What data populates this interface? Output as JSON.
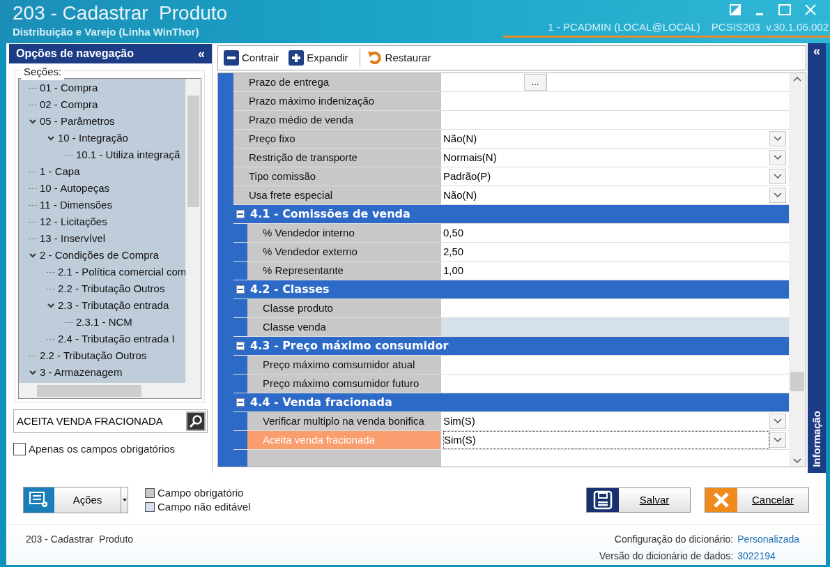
{
  "window": {
    "title": "203 - Cadastrar  Produto",
    "subtitle": "Distribuição e Varejo (Linha WinThor)",
    "user": "1 - PCADMIN (LOCAL@LOCAL)",
    "version": "PCSIS203  v.30.1.06.002"
  },
  "navigation": {
    "title": "Opções de navegação",
    "collapse": "«",
    "sections_label": "Seções:",
    "tree": [
      {
        "label": "01 - Compra"
      },
      {
        "label": "02 - Compra"
      },
      {
        "label": "05 - Parâmetros",
        "expanded": true,
        "children": [
          {
            "label": "10 - Integração",
            "expanded": true,
            "children": [
              {
                "label": "10.1 - Utiliza integraçã"
              }
            ]
          }
        ]
      },
      {
        "label": "1 - Capa"
      },
      {
        "label": "10 - Autopeças"
      },
      {
        "label": "11 - Dimensões"
      },
      {
        "label": "12 - Licitações"
      },
      {
        "label": "13 - Inservível"
      },
      {
        "label": "2 - Condições de Compra",
        "expanded": true,
        "children": [
          {
            "label": "2.1 - Política comercial com"
          },
          {
            "label": "2.2 - Tributação Outros"
          },
          {
            "label": "2.3 - Tributação entrada",
            "expanded": true,
            "children": [
              {
                "label": "2.3.1 - NCM"
              }
            ]
          },
          {
            "label": "2.4 - Tributação entrada I"
          }
        ]
      },
      {
        "label": "2.2 - Tributação Outros"
      },
      {
        "label": "3 - Armazenagem",
        "expanded": true
      }
    ],
    "search": {
      "value": "ACEITA VENDA FRACIONADA"
    },
    "only_required": {
      "label": "Apenas os campos obrigatórios",
      "checked": false
    }
  },
  "toolbar": [
    {
      "kind": "collapse",
      "label": "Contrair"
    },
    {
      "kind": "expand",
      "label": "Expandir"
    },
    {
      "kind": "restore",
      "label": "Restaurar"
    }
  ],
  "grid": {
    "rows": [
      {
        "label": "Prazo de entrega",
        "kind": "ellipsis",
        "value": "",
        "ellipsis": "...",
        "selected": false,
        "disabled": false
      },
      {
        "label": "Prazo máximo indenização",
        "kind": "text",
        "value": "",
        "selected": false,
        "disabled": false
      },
      {
        "label": "Prazo médio de venda",
        "kind": "text",
        "value": "",
        "selected": false,
        "disabled": false
      },
      {
        "label": "Preço fixo",
        "kind": "dropdown",
        "value": "Não(N)",
        "selected": false,
        "disabled": false
      },
      {
        "label": "Restrição de transporte",
        "kind": "dropdown",
        "value": "Normais(N)",
        "selected": false,
        "disabled": false
      },
      {
        "label": "Tipo comissão",
        "kind": "dropdown",
        "value": "Padrão(P)",
        "selected": false,
        "disabled": false
      },
      {
        "label": "Usa frete especial",
        "kind": "dropdown",
        "value": "Não(N)",
        "selected": false,
        "disabled": false
      }
    ],
    "sections": [
      {
        "title": "4.1 - Comissões de venda",
        "expanded": true,
        "rows": [
          {
            "label": "% Vendedor interno",
            "kind": "text",
            "value": "0,50",
            "selected": false,
            "disabled": false
          },
          {
            "label": "% Vendedor externo",
            "kind": "text",
            "value": "2,50",
            "selected": false,
            "disabled": false
          },
          {
            "label": "% Representante",
            "kind": "text",
            "value": "1,00",
            "selected": false,
            "disabled": false
          }
        ]
      },
      {
        "title": "4.2 - Classes",
        "expanded": true,
        "rows": [
          {
            "label": "Classe produto",
            "kind": "text",
            "value": "",
            "selected": false,
            "disabled": false
          },
          {
            "label": "Classe venda",
            "kind": "text",
            "value": "",
            "selected": false,
            "disabled": true
          }
        ]
      },
      {
        "title": "4.3 - Preço máximo consumidor",
        "expanded": true,
        "rows": [
          {
            "label": "Preço máximo comsumidor atual",
            "kind": "text",
            "value": "",
            "selected": false,
            "disabled": false
          },
          {
            "label": "Preço máximo comsumidor futuro",
            "kind": "text",
            "value": "",
            "selected": false,
            "disabled": false
          }
        ]
      },
      {
        "title": "4.4 - Venda fracionada",
        "expanded": true,
        "rows": [
          {
            "label": "Verificar multiplo na venda bonifica",
            "kind": "dropdown",
            "value": "Sim(S)",
            "selected": false,
            "disabled": false
          },
          {
            "label": "Aceita venda fracionada",
            "kind": "dropdown",
            "value": "Sim(S)",
            "selected": true,
            "disabled": false
          }
        ]
      }
    ]
  },
  "info_panel": {
    "label": "Informação",
    "collapse": "«"
  },
  "actions": {
    "label": "Ações"
  },
  "legend": [
    {
      "kind": "required",
      "label": "Campo obrigatório"
    },
    {
      "kind": "readonly",
      "label": "Campo não editável"
    }
  ],
  "buttons": [
    {
      "kind": "save",
      "label": "Salvar"
    },
    {
      "kind": "cancel",
      "label": "Cancelar"
    }
  ],
  "status_bar": {
    "title": "203 - Cadastrar  Produto",
    "config_label": "Configuração do dicionário:",
    "config_value": "Personalizada",
    "version_label": "Versão do dicionário de dados:",
    "version_value": "3022194"
  }
}
